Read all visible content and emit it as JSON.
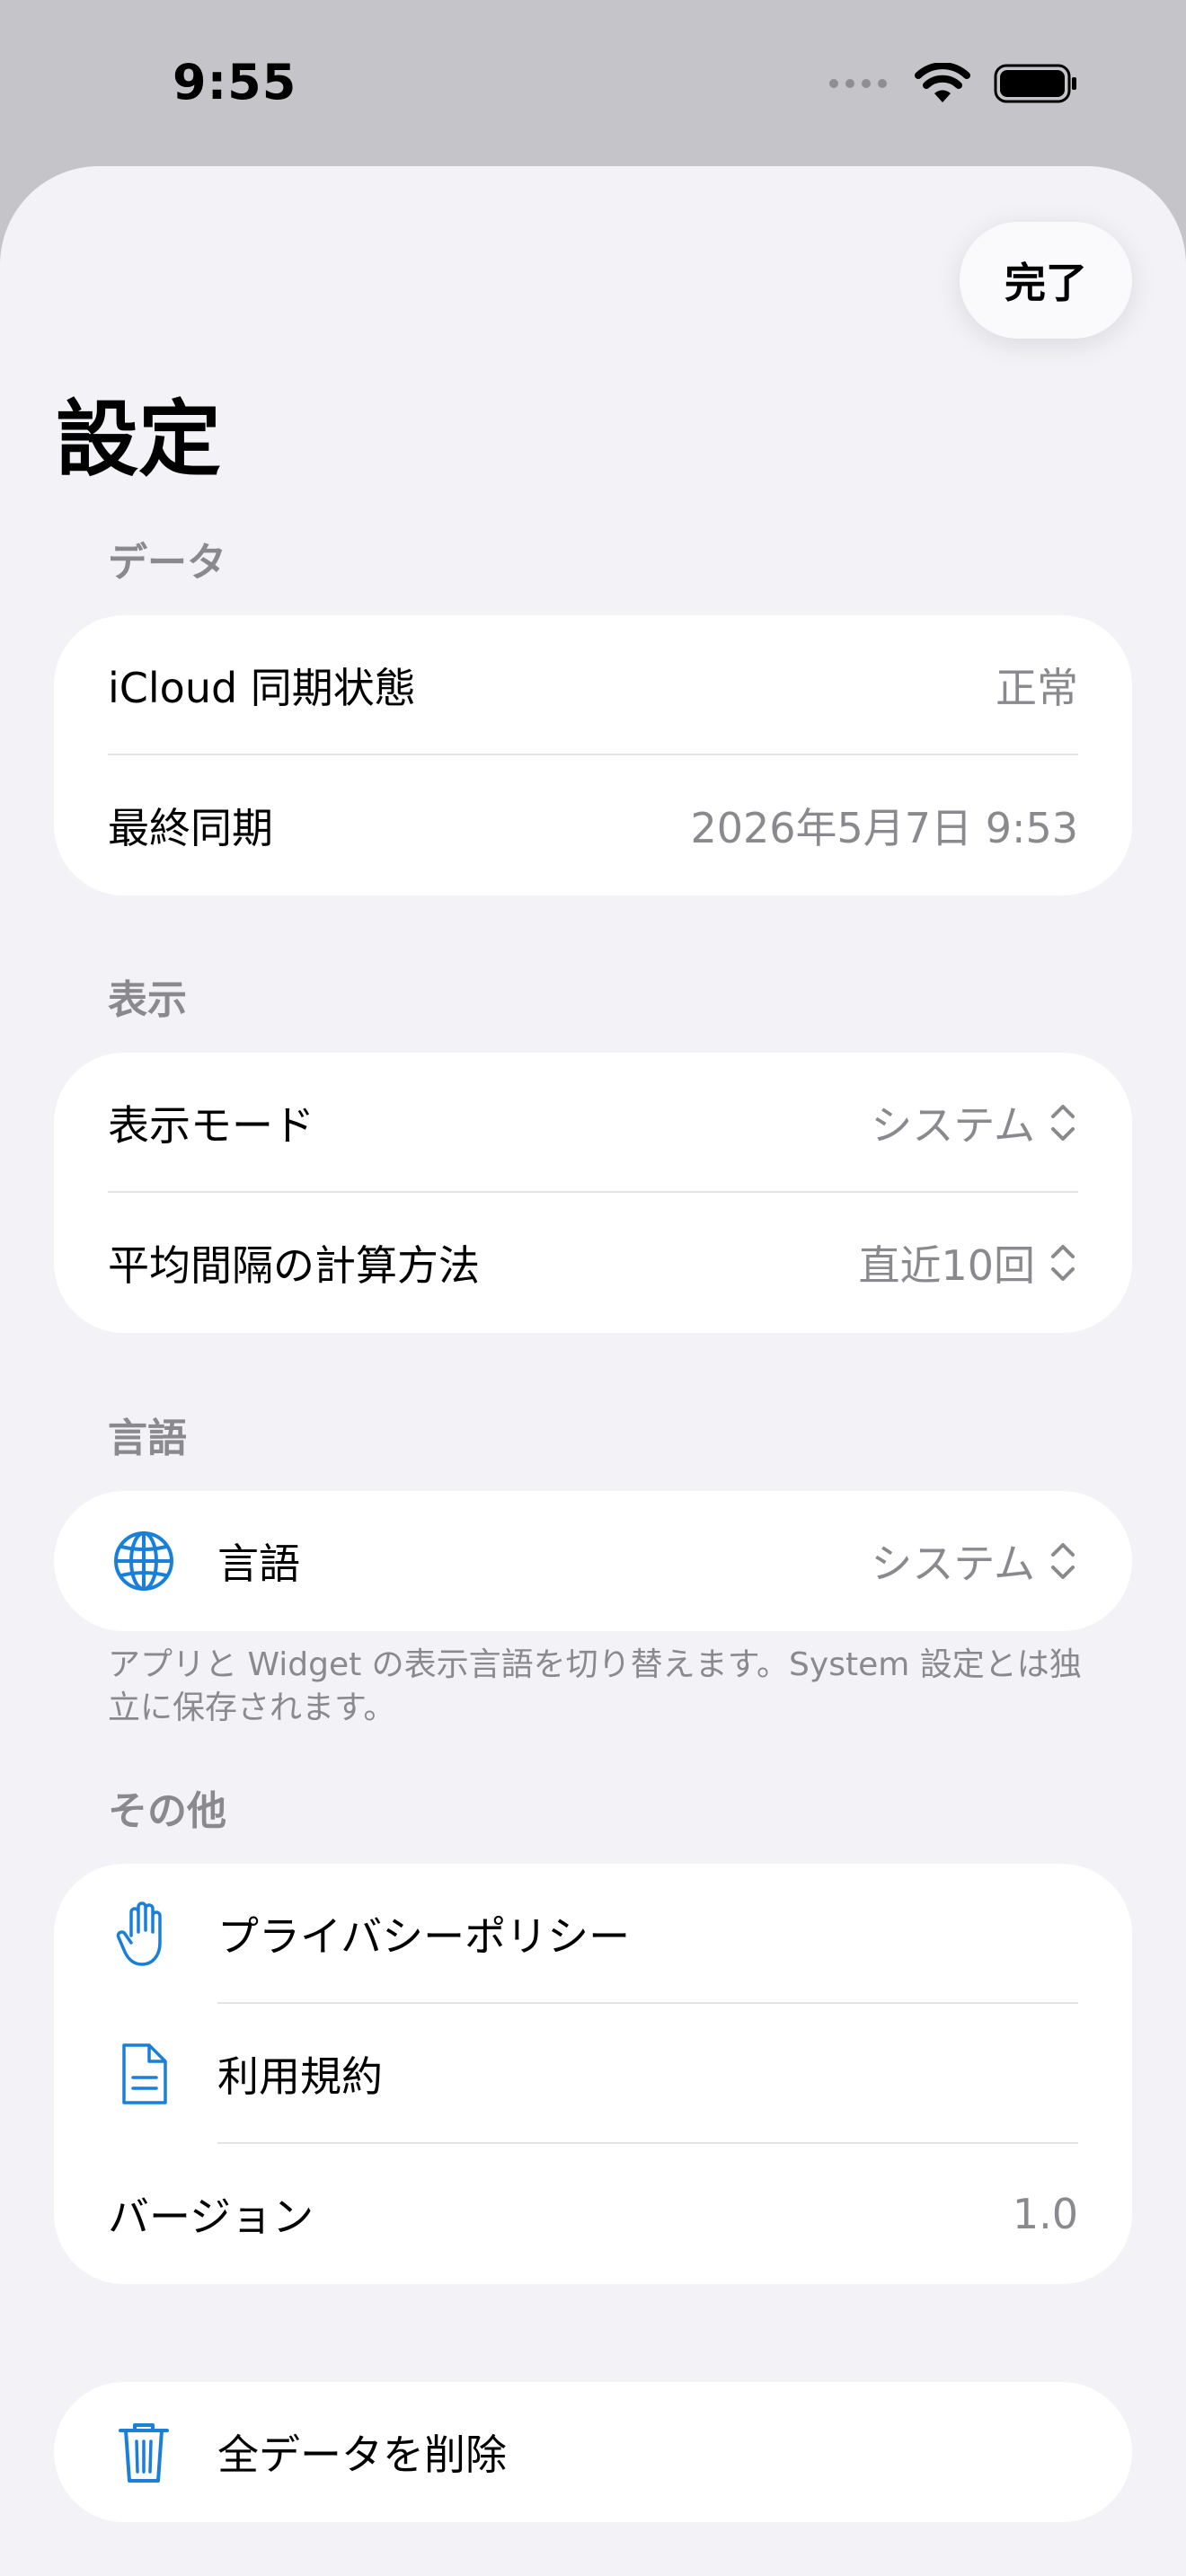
{
  "status_bar": {
    "time": "9:55"
  },
  "header": {
    "done_label": "完了",
    "title": "設定"
  },
  "sections": {
    "data": {
      "header": "データ",
      "rows": [
        {
          "label": "iCloud 同期状態",
          "value": "正常"
        },
        {
          "label": "最終同期",
          "value": "2026年5月7日 9:53"
        }
      ]
    },
    "display": {
      "header": "表示",
      "rows": [
        {
          "label": "表示モード",
          "value": "システム"
        },
        {
          "label": "平均間隔の計算方法",
          "value": "直近10回"
        }
      ]
    },
    "language": {
      "header": "言語",
      "row": {
        "label": "言語",
        "value": "システム",
        "icon": "globe-icon"
      },
      "footnote": "アプリと Widget の表示言語を切り替えます。System 設定とは独立に保存されます。"
    },
    "other": {
      "header": "その他",
      "rows": [
        {
          "label": "プライバシーポリシー",
          "icon": "hand-icon"
        },
        {
          "label": "利用規約",
          "icon": "document-icon"
        },
        {
          "label": "バージョン",
          "value": "1.0"
        }
      ]
    },
    "danger": {
      "label": "全データを削除",
      "icon": "trash-icon"
    }
  },
  "colors": {
    "accent": "#1a7fd9",
    "destructive": "#e5352c",
    "secondary_text": "#8a8a8e",
    "background": "#f2f2f7"
  }
}
